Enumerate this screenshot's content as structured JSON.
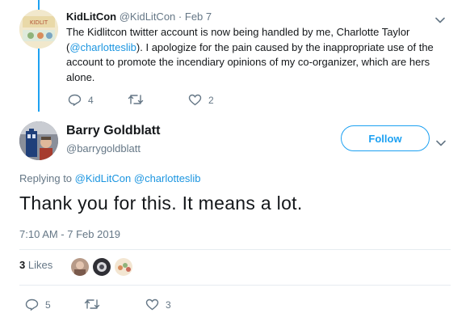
{
  "parent_tweet": {
    "display_name": "KidLitCon",
    "handle": "@KidLitCon",
    "separator": "·",
    "date": "Feb 7",
    "text_1": "The Kidlitcon twitter account is now being handled by me, Charlotte Taylor (",
    "mention": "@charlotteslib",
    "text_2": ").  I apologize for the pain caused by the inappropriate use of the account to promote the incendiary opinions of my co-organizer, which are hers alone.",
    "reply_count": "4",
    "retweet_count": "",
    "like_count": "2"
  },
  "main_tweet": {
    "display_name": "Barry Goldblatt",
    "handle": "@barrygoldblatt",
    "follow_label": "Follow",
    "replying_prefix": "Replying to",
    "replying_to_1": "@KidLitCon",
    "replying_to_2": "@charlotteslib",
    "text": "Thank you for this. It means a lot.",
    "timestamp": "7:10 AM - 7 Feb 2019",
    "likes_count": "3",
    "likes_label": "Likes",
    "reply_count": "5",
    "retweet_count": "",
    "like_count": "3"
  },
  "colors": {
    "accent": "#1da1f2",
    "link": "#1b95e0",
    "muted": "#657786",
    "divider": "#e6ecf0"
  }
}
